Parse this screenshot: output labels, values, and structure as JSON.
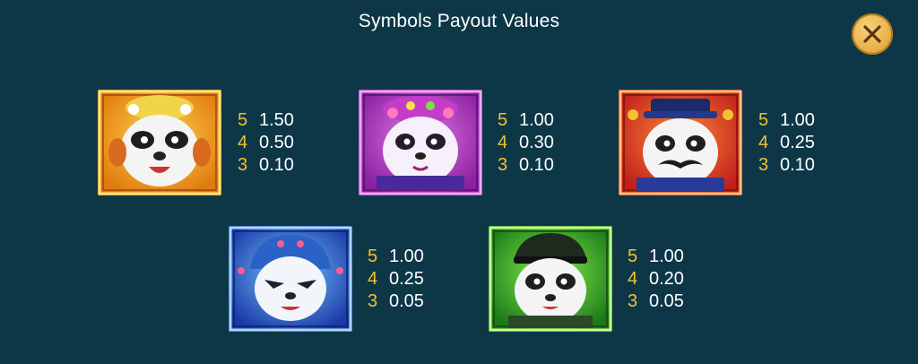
{
  "header": {
    "title": "Symbols Payout Values",
    "close_icon": "close-icon"
  },
  "colors": {
    "background": "#0d3747",
    "count": "#f2c230",
    "value": "#ffffff",
    "close_button": "#e9b24a"
  },
  "symbols": [
    {
      "icon": "panda-orange-icon",
      "frame": "#e08c10",
      "payouts": [
        {
          "count": "5",
          "value": "1.50"
        },
        {
          "count": "4",
          "value": "0.50"
        },
        {
          "count": "3",
          "value": "0.10"
        }
      ]
    },
    {
      "icon": "panda-purple-icon",
      "frame": "#b040c0",
      "payouts": [
        {
          "count": "5",
          "value": "1.00"
        },
        {
          "count": "4",
          "value": "0.30"
        },
        {
          "count": "3",
          "value": "0.10"
        }
      ]
    },
    {
      "icon": "panda-red-icon",
      "frame": "#d8401c",
      "payouts": [
        {
          "count": "5",
          "value": "1.00"
        },
        {
          "count": "4",
          "value": "0.25"
        },
        {
          "count": "3",
          "value": "0.10"
        }
      ]
    },
    {
      "icon": "panda-blue-icon",
      "frame": "#2a5ad0",
      "payouts": [
        {
          "count": "5",
          "value": "1.00"
        },
        {
          "count": "4",
          "value": "0.25"
        },
        {
          "count": "3",
          "value": "0.05"
        }
      ]
    },
    {
      "icon": "panda-green-icon",
      "frame": "#2aa82a",
      "payouts": [
        {
          "count": "5",
          "value": "1.00"
        },
        {
          "count": "4",
          "value": "0.20"
        },
        {
          "count": "3",
          "value": "0.05"
        }
      ]
    }
  ]
}
